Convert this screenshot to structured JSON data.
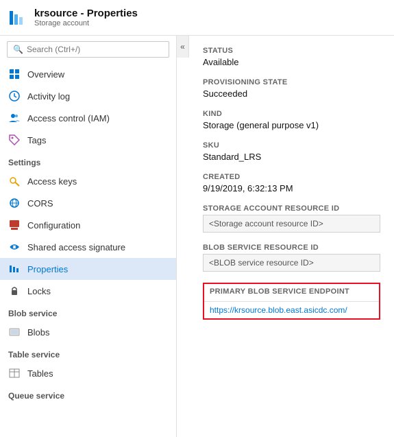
{
  "header": {
    "title": "krsource - Properties",
    "subtitle": "Storage account"
  },
  "search": {
    "placeholder": "Search (Ctrl+/)"
  },
  "sidebar": {
    "top_items": [
      {
        "id": "overview",
        "label": "Overview",
        "icon": "overview"
      },
      {
        "id": "activity-log",
        "label": "Activity log",
        "icon": "activity"
      },
      {
        "id": "access-control",
        "label": "Access control (IAM)",
        "icon": "iam"
      },
      {
        "id": "tags",
        "label": "Tags",
        "icon": "tags"
      }
    ],
    "sections": [
      {
        "label": "Settings",
        "items": [
          {
            "id": "access-keys",
            "label": "Access keys",
            "icon": "key"
          },
          {
            "id": "cors",
            "label": "CORS",
            "icon": "cors"
          },
          {
            "id": "configuration",
            "label": "Configuration",
            "icon": "config"
          },
          {
            "id": "shared-access",
            "label": "Shared access signature",
            "icon": "link"
          },
          {
            "id": "properties",
            "label": "Properties",
            "icon": "properties",
            "active": true
          },
          {
            "id": "locks",
            "label": "Locks",
            "icon": "lock"
          }
        ]
      },
      {
        "label": "Blob service",
        "items": [
          {
            "id": "blobs",
            "label": "Blobs",
            "icon": "blobs"
          }
        ]
      },
      {
        "label": "Table service",
        "items": [
          {
            "id": "tables",
            "label": "Tables",
            "icon": "tables"
          }
        ]
      },
      {
        "label": "Queue service",
        "items": []
      }
    ]
  },
  "properties": {
    "status_label": "STATUS",
    "status_value": "Available",
    "provisioning_label": "PROVISIONING STATE",
    "provisioning_value": "Succeeded",
    "kind_label": "KIND",
    "kind_value": "Storage (general purpose v1)",
    "sku_label": "SKU",
    "sku_value": "Standard_LRS",
    "created_label": "CREATED",
    "created_value": "9/19/2019, 6:32:13 PM",
    "storage_resource_id_label": "STORAGE ACCOUNT RESOURCE ID",
    "storage_resource_id_placeholder": "<Storage account resource ID>",
    "blob_resource_id_label": "BLOB SERVICE RESOURCE ID",
    "blob_resource_id_placeholder": "<BLOB service resource ID>",
    "endpoint_label": "PRIMARY BLOB SERVICE ENDPOINT",
    "endpoint_value": "https://krsource.blob.east.asicdc.com/"
  }
}
